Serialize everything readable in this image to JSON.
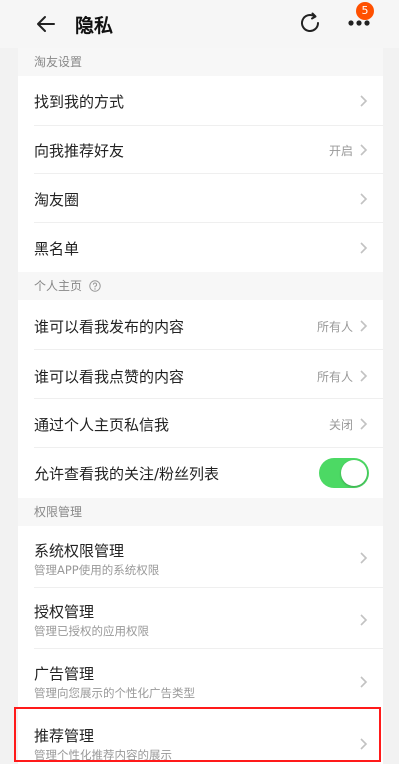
{
  "header": {
    "title": "隐私",
    "badge_count": "5"
  },
  "sections": [
    {
      "title": "淘友设置"
    },
    {
      "title": "个人主页"
    },
    {
      "title": "权限管理"
    }
  ],
  "rows": {
    "find_me": {
      "label": "找到我的方式"
    },
    "recommend_friends": {
      "label": "向我推荐好友",
      "value": "开启"
    },
    "taoyou_circle": {
      "label": "淘友圈"
    },
    "blacklist": {
      "label": "黑名单"
    },
    "who_posts": {
      "label": "谁可以看我发布的内容",
      "value": "所有人"
    },
    "who_likes": {
      "label": "谁可以看我点赞的内容",
      "value": "所有人"
    },
    "dm_homepage": {
      "label": "通过个人主页私信我",
      "value": "关闭"
    },
    "follow_list": {
      "label": "允许查看我的关注/粉丝列表",
      "enabled": true
    },
    "sys_perm": {
      "label": "系统权限管理",
      "sub": "管理APP使用的系统权限"
    },
    "auth_mgmt": {
      "label": "授权管理",
      "sub": "管理已授权的应用权限"
    },
    "ad_mgmt": {
      "label": "广告管理",
      "sub": "管理向您展示的个性化广告类型"
    },
    "rec_mgmt": {
      "label": "推荐管理",
      "sub": "管理个性化推荐内容的展示"
    }
  },
  "colors": {
    "accent_badge": "#ff5000",
    "toggle_on": "#4cd964",
    "highlight_border": "#ff1a1a"
  }
}
